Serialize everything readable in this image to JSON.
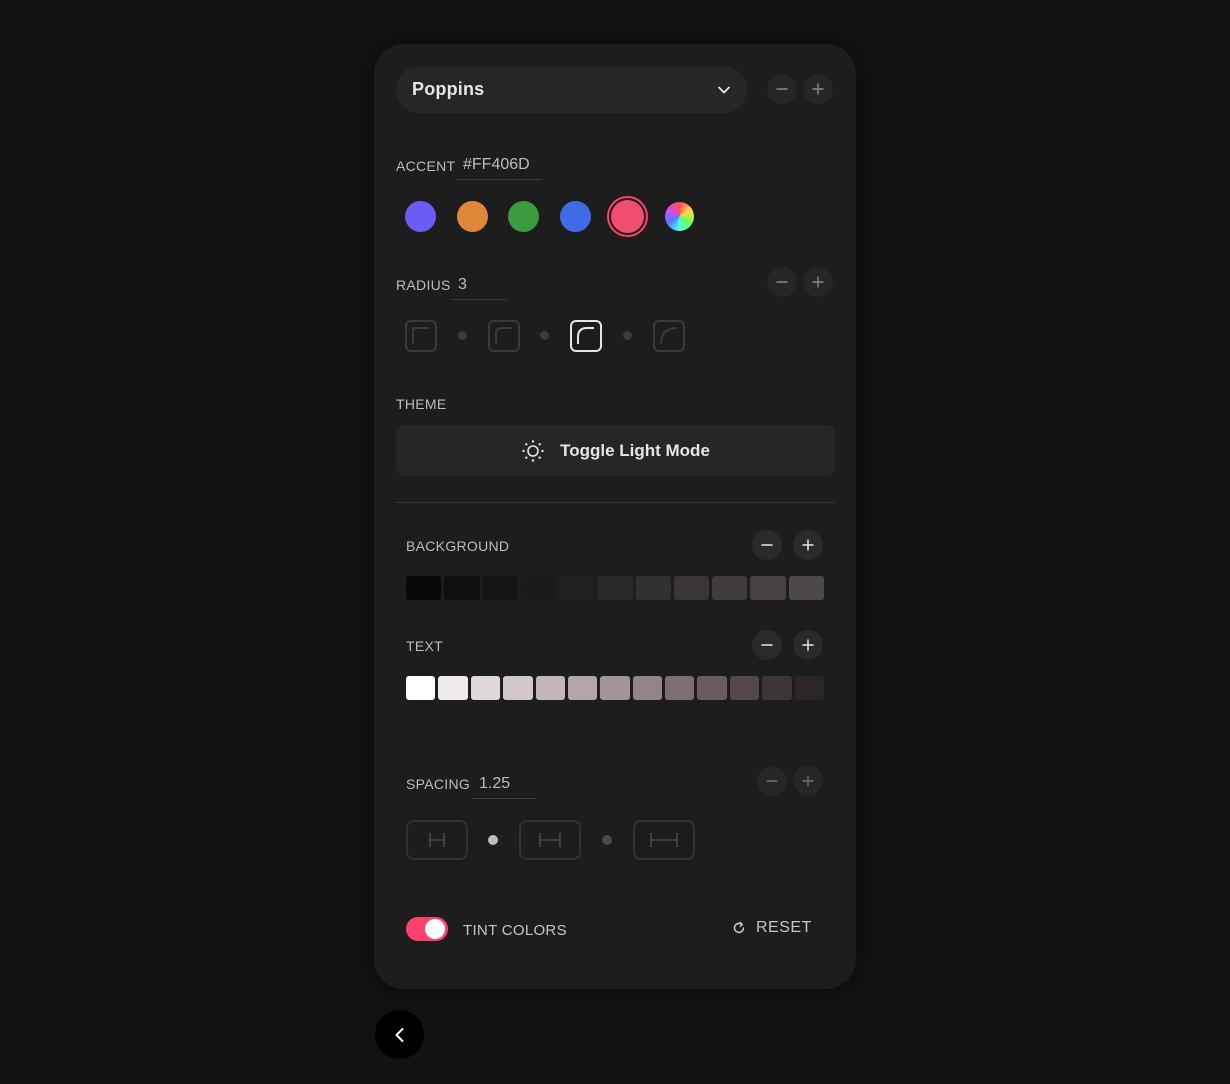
{
  "font": {
    "selected": "Poppins"
  },
  "accent": {
    "label": "ACCENT",
    "value": "#FF406D",
    "swatches": [
      "#6C5CF4",
      "#E0883A",
      "#3C9A3F",
      "#3F6CE6",
      "#F04E6E"
    ]
  },
  "radius": {
    "label": "RADIUS",
    "value": "3"
  },
  "theme": {
    "label": "THEME",
    "toggle_label": "Toggle Light Mode"
  },
  "background": {
    "label": "BACKGROUND",
    "scale": [
      "#080808",
      "#0f0f0f",
      "#141414",
      "#1a1a1a",
      "#222021",
      "#2a2728",
      "#333031",
      "#3a3536",
      "#403b3c",
      "#474142",
      "#4e4849"
    ]
  },
  "text": {
    "label": "TEXT",
    "scale": [
      "#ffffff",
      "#efebec",
      "#e0d8da",
      "#d1c7c9",
      "#c2b6b8",
      "#b3a5a8",
      "#a39497",
      "#948387",
      "#7e6d71",
      "#685a5d",
      "#534749",
      "#3e3537",
      "#2d2527"
    ]
  },
  "spacing": {
    "label": "SPACING",
    "value": "1.25"
  },
  "footer": {
    "tint_label": "TINT COLORS",
    "reset_label": "RESET"
  },
  "colors": {
    "accent": "#FF406D"
  }
}
